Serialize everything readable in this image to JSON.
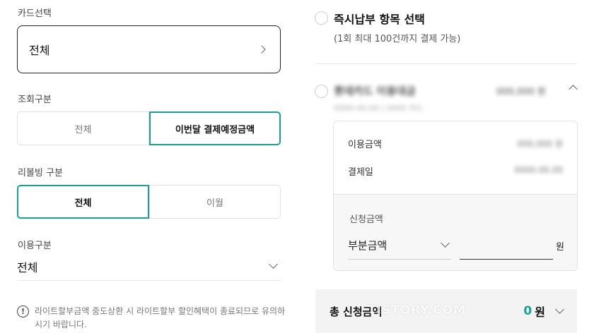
{
  "card_select": {
    "label": "카드선택",
    "value": "전체"
  },
  "inquiry_type": {
    "label": "조회구분",
    "options": [
      "전체",
      "이번달 결제예정금액"
    ],
    "selected": "이번달 결제예정금액"
  },
  "revolving_type": {
    "label": "리볼빙 구분",
    "options": [
      "전체",
      "이월"
    ],
    "selected": "전체"
  },
  "usage_type": {
    "label": "이용구분",
    "value": "전체"
  },
  "notice": {
    "text": "라이트할부금액 중도상환 시 라이트할부 할인혜택이 종료되므로 유의하시기 바랍니다."
  },
  "instant_payment": {
    "title": "즉시납부 항목 선택",
    "subtitle": "(1회 최대 100건까지 결제 가능)"
  },
  "item": {
    "name": "롯데카드 이용대금",
    "amount": "000,000 원",
    "meta": "0000-00-00 | 0000 카드",
    "detail": {
      "usage_amount_label": "이용금액",
      "usage_amount_value": "000,000 원",
      "payment_date_label": "결제일",
      "payment_date_value": "0000.00.00",
      "request_amount_label": "신청금액",
      "request_type": "부분금액",
      "amount_unit": "원"
    }
  },
  "total": {
    "label": "총 신청금액",
    "value": "0",
    "unit": "원"
  },
  "watermark": "TISTORY.COM",
  "colors": {
    "accent": "#18a096"
  }
}
